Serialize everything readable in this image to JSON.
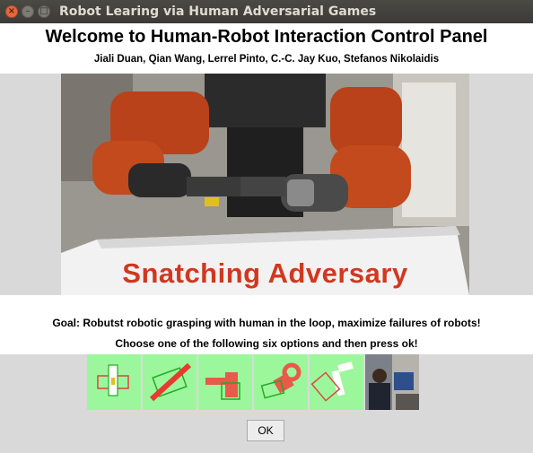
{
  "window": {
    "title": "Robot Learing via Human Adversarial Games",
    "close_glyph": "×",
    "minimize_glyph": "–",
    "maximize_glyph": "□"
  },
  "header": {
    "title": "Welcome to Human-Robot Interaction Control Panel",
    "authors": "Jiali Duan, Qian Wang, Lerrel Pinto, C.-C. Jay Kuo, Stefanos Nikolaidis"
  },
  "hero": {
    "caption": "Snatching Adversary"
  },
  "info": {
    "goal": "Goal: Robutst robotic grasping with human in the loop, maximize failures of robots!",
    "instructions": "Choose one of the following six options and then press ok!"
  },
  "options": [
    {
      "icon": "grasp-option-1-icon"
    },
    {
      "icon": "grasp-option-2-icon"
    },
    {
      "icon": "grasp-option-3-icon"
    },
    {
      "icon": "grasp-option-4-icon"
    },
    {
      "icon": "grasp-option-5-icon"
    },
    {
      "icon": "human-operator-photo-icon"
    }
  ],
  "ok_button": {
    "label": "OK"
  },
  "colors": {
    "option_bg": "#9cf79c",
    "adversary_red": "#d0381f",
    "titlebar": "#3c3b37"
  }
}
